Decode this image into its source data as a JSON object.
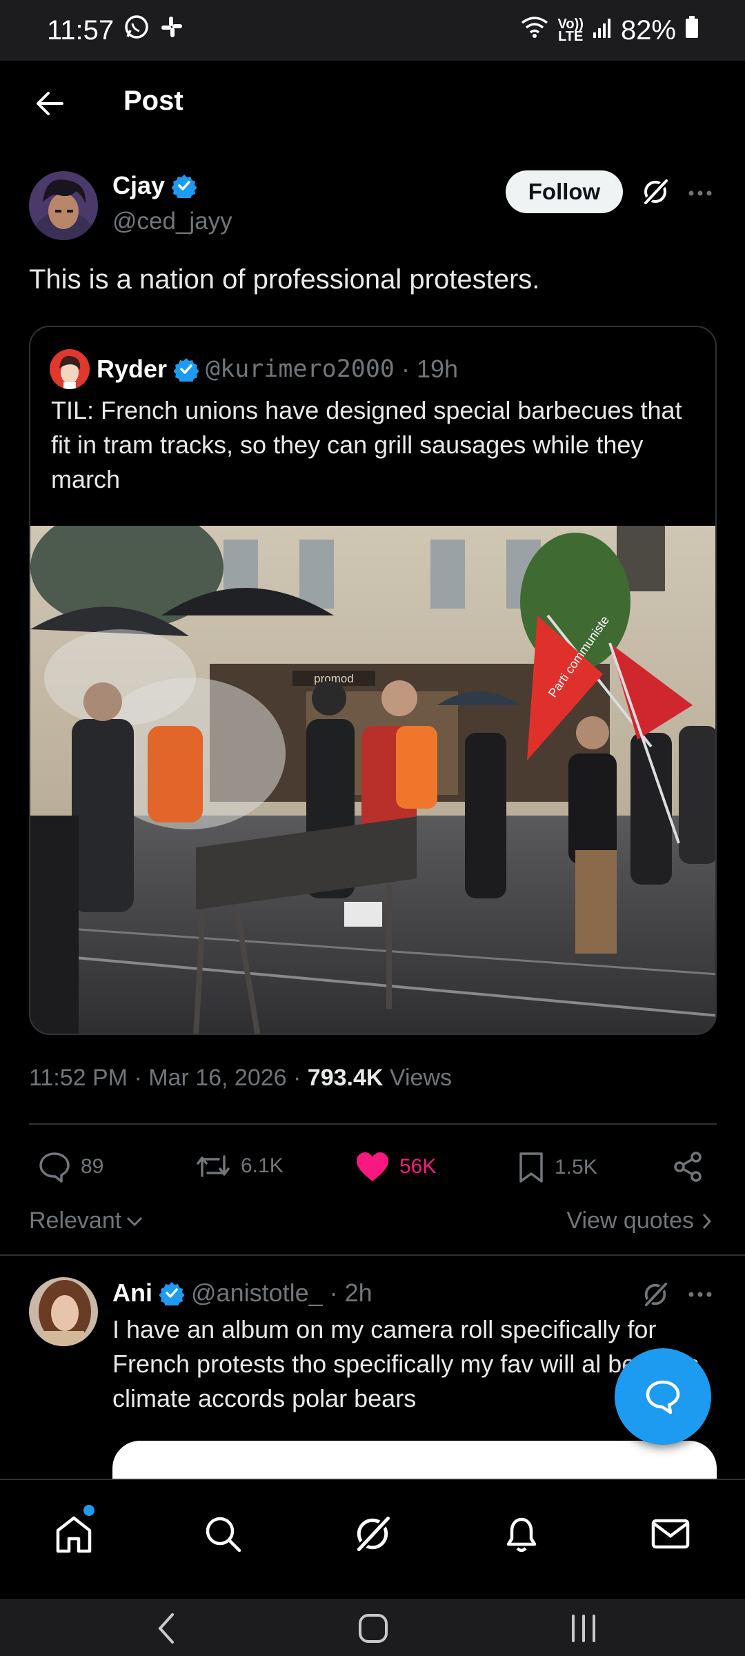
{
  "status": {
    "time": "11:57",
    "network_top": "Vo))",
    "network_bottom": "LTE",
    "battery": "82%"
  },
  "header": {
    "title": "Post"
  },
  "post": {
    "author_name": "Cjay",
    "author_handle": "@ced_jayy",
    "follow_label": "Follow",
    "text": "This is a nation of professional protesters.",
    "timestamp": "11:52 PM · Mar 16, 2026 · ",
    "views_count": "793.4K",
    "views_label": " Views"
  },
  "quote": {
    "name": "Ryder",
    "handle": "@kurimero2000",
    "time": "· 19h",
    "text": "TIL:  French unions have designed special barbecues that fit in tram tracks, so they can grill sausages while they march",
    "photo_sign": "promod",
    "flag_text": "Parti communiste"
  },
  "actions": {
    "replies": "89",
    "reposts": "6.1K",
    "likes": "56K",
    "bookmarks": "1.5K"
  },
  "sort": {
    "left": "Relevant",
    "right": "View quotes"
  },
  "reply": {
    "name": "Ani",
    "handle": "@anistotle_",
    "time": "· 2h",
    "text": "I have an album on my camera roll specifically for French protests tho specifically my fav will al be Paris climate accords polar bears"
  },
  "colors": {
    "accent": "#1d9bf0",
    "like": "#f91880",
    "muted": "#71767b"
  }
}
